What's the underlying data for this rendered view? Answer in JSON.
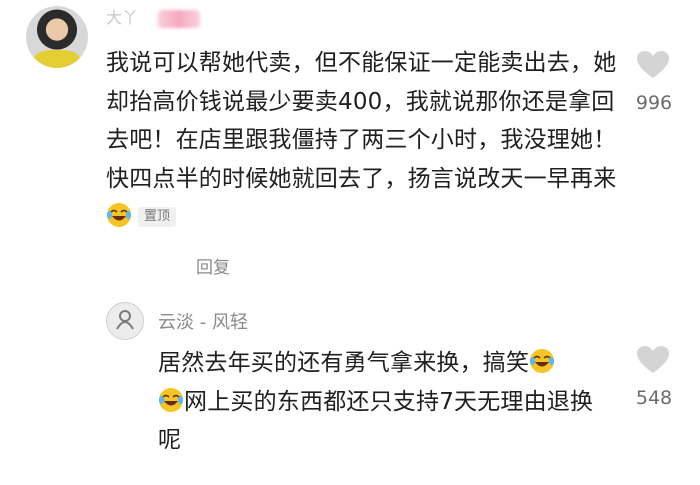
{
  "comment": {
    "username": "大丫",
    "text_main": "我说可以帮她代卖，但不能保证一定能卖出去，她却抬高价钱说最少要卖400，我就说那你还是拿回去吧！在店里跟我僵持了两三个小时，我没理她！快四点半的时候她就回去了，扬言说改天一早再来",
    "pinned_label": "置顶",
    "reply_label": "回复",
    "like_count": "996",
    "emoji": "laughing-tears-emoji"
  },
  "reply": {
    "username": "云淡 - 风轻",
    "text_line1": "居然去年买的还有勇气拿来换，搞笑",
    "text_line2": "网上买的东西都还只支持7天无理由退换呢",
    "like_count": "548",
    "emoji": "laughing-tears-emoji"
  },
  "colors": {
    "text": "#202020",
    "secondary": "#8a8a8a",
    "heart": "#d4d4d4",
    "emoji_face": "#f6c425"
  }
}
